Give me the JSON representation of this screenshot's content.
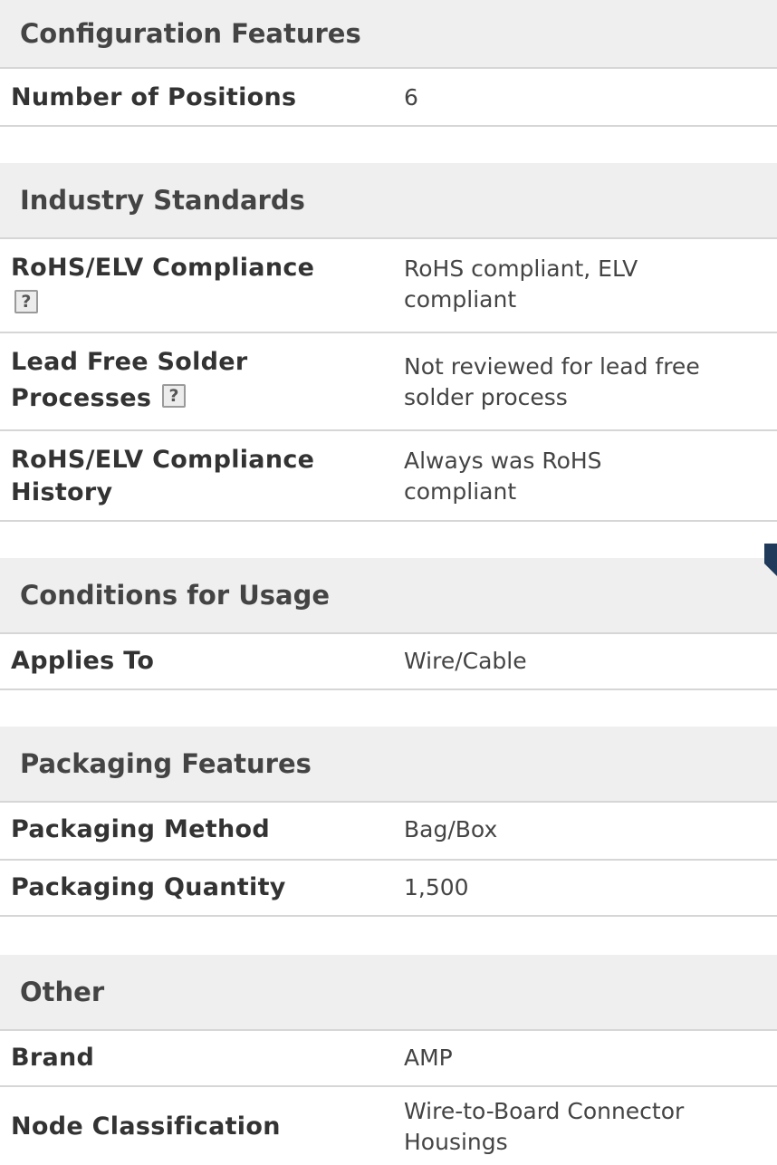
{
  "sections": {
    "configuration": {
      "title": "Configuration Features",
      "rows": [
        {
          "label": "Number of Positions",
          "value": "6"
        }
      ]
    },
    "industry": {
      "title": "Industry Standards",
      "rows": [
        {
          "label_line1": "RoHS/ELV Compliance",
          "value_line1": "RoHS compliant, ELV",
          "value_line2": "compliant"
        },
        {
          "label_line1": "Lead Free Solder",
          "label_line2": "Processes",
          "value_line1": "Not reviewed for lead free",
          "value_line2": "solder process"
        },
        {
          "label_line1": "RoHS/ELV Compliance",
          "label_line2": "History",
          "value_line1": "Always was RoHS",
          "value_line2": "compliant"
        }
      ]
    },
    "conditions": {
      "title": "Conditions for Usage",
      "rows": [
        {
          "label": "Applies To",
          "value": "Wire/Cable"
        }
      ]
    },
    "packaging": {
      "title": "Packaging Features",
      "rows": [
        {
          "label": "Packaging Method",
          "value": "Bag/Box"
        },
        {
          "label": "Packaging Quantity",
          "value": "1,500"
        }
      ]
    },
    "other": {
      "title": "Other",
      "rows": [
        {
          "label": "Brand",
          "value": "AMP"
        },
        {
          "label": "Node Classification",
          "value_line1": "Wire-to-Board Connector",
          "value_line2": "Housings"
        }
      ]
    }
  },
  "icons": {
    "help": "?"
  },
  "colors": {
    "header_bg": "#efefef",
    "divider": "#d6d6d6",
    "corner_mark": "#1f3a5a"
  }
}
